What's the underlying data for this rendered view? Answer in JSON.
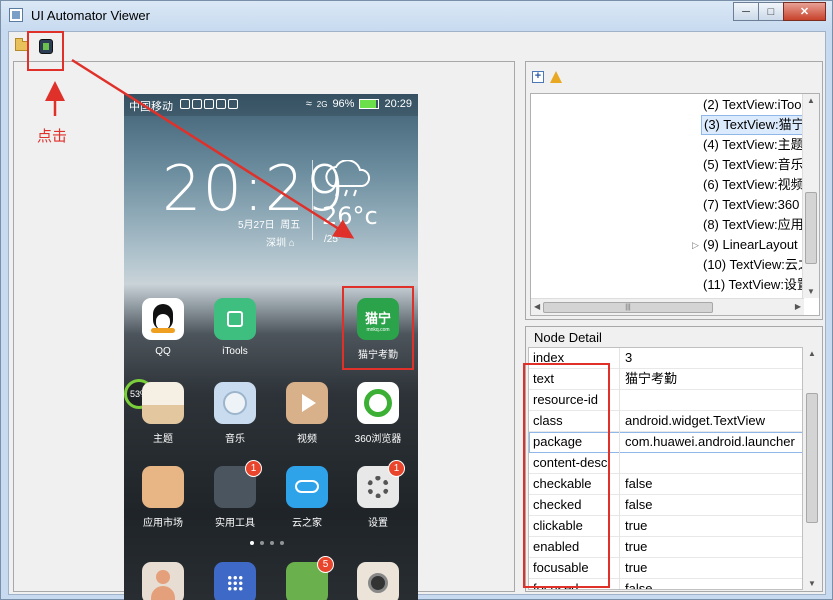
{
  "window": {
    "title": "UI Automator Viewer"
  },
  "phone": {
    "carrier": "中国移动",
    "signal": "2G",
    "battery": "96%",
    "time": "20:29",
    "clock": "20:29",
    "date": "5月27日",
    "weekday": "周五",
    "city": "深圳",
    "temperature": "26°c",
    "temp_range": "/25°",
    "storage_pct": "53%",
    "apps_row1": [
      {
        "label": "QQ",
        "color": "#ffffff"
      },
      {
        "label": "iTools",
        "color": "#3fbf7f"
      },
      {
        "label": "猫宁考勤",
        "color": "#2aa34a",
        "icon_text": "猫宁",
        "icon_sub": "mnkq.com"
      }
    ],
    "apps_row2": [
      {
        "label": "主题",
        "color": "#f3e6d4"
      },
      {
        "label": "音乐",
        "color": "#c9dcef"
      },
      {
        "label": "视频",
        "color": "#d8b08a"
      },
      {
        "label": "360浏览器",
        "color": "#ffffff"
      }
    ],
    "apps_row3": [
      {
        "label": "应用市场",
        "color": "#e8b684"
      },
      {
        "label": "实用工具",
        "color": "#4a5560",
        "badge": "1"
      },
      {
        "label": "云之家",
        "color": "#2fa3ea"
      },
      {
        "label": "设置",
        "color": "#e8e8e8",
        "badge": "1"
      }
    ],
    "dock": [
      {
        "color": "#e8ddd2"
      },
      {
        "color": "#3f69c6"
      },
      {
        "color": "#6ab04c",
        "badge": "5"
      },
      {
        "color": "#ece4d8"
      }
    ]
  },
  "annotation": {
    "text": "点击"
  },
  "tree": {
    "rows": [
      "(2) TextView:iToo",
      "(3) TextView:猫宁",
      "(4) TextView:主题",
      "(5) TextView:音乐",
      "(6) TextView:视频",
      "(7) TextView:360",
      "(8) TextView:应用",
      "(9) LinearLayout",
      "(10) TextView:云之",
      "(11) TextView:设置"
    ],
    "selected_index": 1
  },
  "node_detail": {
    "title": "Node Detail",
    "rows": [
      {
        "key": "index",
        "value": "3"
      },
      {
        "key": "text",
        "value": "猫宁考勤"
      },
      {
        "key": "resource-id",
        "value": ""
      },
      {
        "key": "class",
        "value": "android.widget.TextView"
      },
      {
        "key": "package",
        "value": "com.huawei.android.launcher"
      },
      {
        "key": "content-desc",
        "value": ""
      },
      {
        "key": "checkable",
        "value": "false"
      },
      {
        "key": "checked",
        "value": "false"
      },
      {
        "key": "clickable",
        "value": "true"
      },
      {
        "key": "enabled",
        "value": "true"
      },
      {
        "key": "focusable",
        "value": "true"
      },
      {
        "key": "focused",
        "value": "false"
      }
    ]
  },
  "colors": {
    "highlight": "#e0302a",
    "selection": "#dbeafc"
  }
}
